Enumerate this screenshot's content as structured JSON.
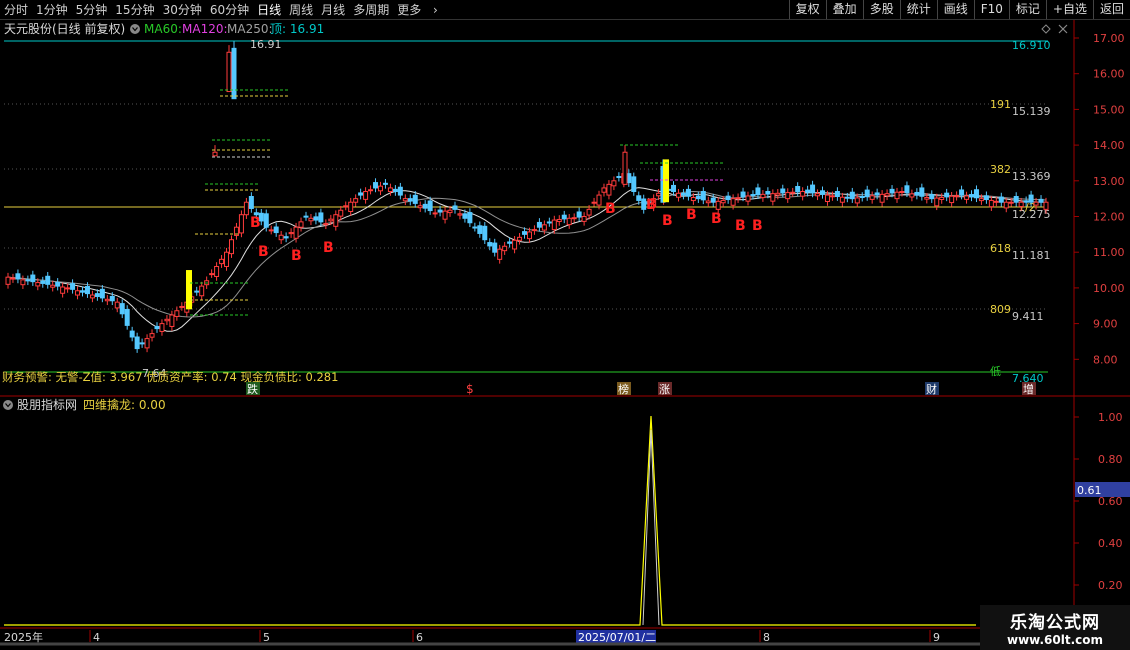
{
  "toolbar": {
    "periods": [
      "分时",
      "1分钟",
      "5分钟",
      "15分钟",
      "30分钟",
      "60分钟",
      "日线",
      "周线",
      "月线",
      "多周期",
      "更多"
    ],
    "active_period": "日线",
    "buttons": [
      "复权",
      "叠加",
      "多股",
      "统计",
      "画线",
      "F10",
      "标记",
      "+自选",
      "返回"
    ]
  },
  "main_title": {
    "stock": "天元股份(日线 前复权)",
    "ma60": "MA60:",
    "ma120": "MA120:",
    "ma250": "MA250:",
    "top_label": "顶: 16.91"
  },
  "colors": {
    "up": "#ff3c3c",
    "down": "#54c8ff",
    "ma_white": "#e0e0e0",
    "ma_green": "#28c828",
    "ma_magenta": "#e040e0",
    "yellow": "#ffff00",
    "axis": "#a00000"
  },
  "price_axis": [
    "17.00",
    "16.00",
    "15.00",
    "14.00",
    "13.00",
    "12.00",
    "11.00",
    "10.00",
    "9.00",
    "8.00"
  ],
  "fib_levels": [
    {
      "ratio": "",
      "price": "16.910"
    },
    {
      "ratio": "191",
      "price": "15.139"
    },
    {
      "ratio": "382",
      "price": "13.369"
    },
    {
      "ratio": "1/2",
      "price": "12.275"
    },
    {
      "ratio": "618",
      "price": "11.181"
    },
    {
      "ratio": "809",
      "price": "9.411"
    },
    {
      "ratio": "低",
      "price": "7.640"
    }
  ],
  "price_labels": {
    "high": "16.91",
    "low": "7.64"
  },
  "finance_text": "财务预警: 无警-Z值: 3.967 优质资产率: 0.74 现金负债比: 0.281",
  "event_markers": [
    "跌",
    "$",
    "榜",
    "涨",
    "财",
    "增"
  ],
  "buy_mark": "B",
  "indicator": {
    "title": "股朋指标网",
    "name": "四维擒龙: 0.00",
    "axis": [
      "1.00",
      "0.80",
      "0.60",
      "0.40",
      "0.20"
    ],
    "cursor_value": "0.61"
  },
  "date_axis": {
    "labels": [
      "2025年",
      "4",
      "5",
      "6",
      "8",
      "9"
    ],
    "highlight": "2025/07/01/二"
  },
  "watermark": {
    "title": "乐淘公式网",
    "url": "www.60lt.com"
  }
}
